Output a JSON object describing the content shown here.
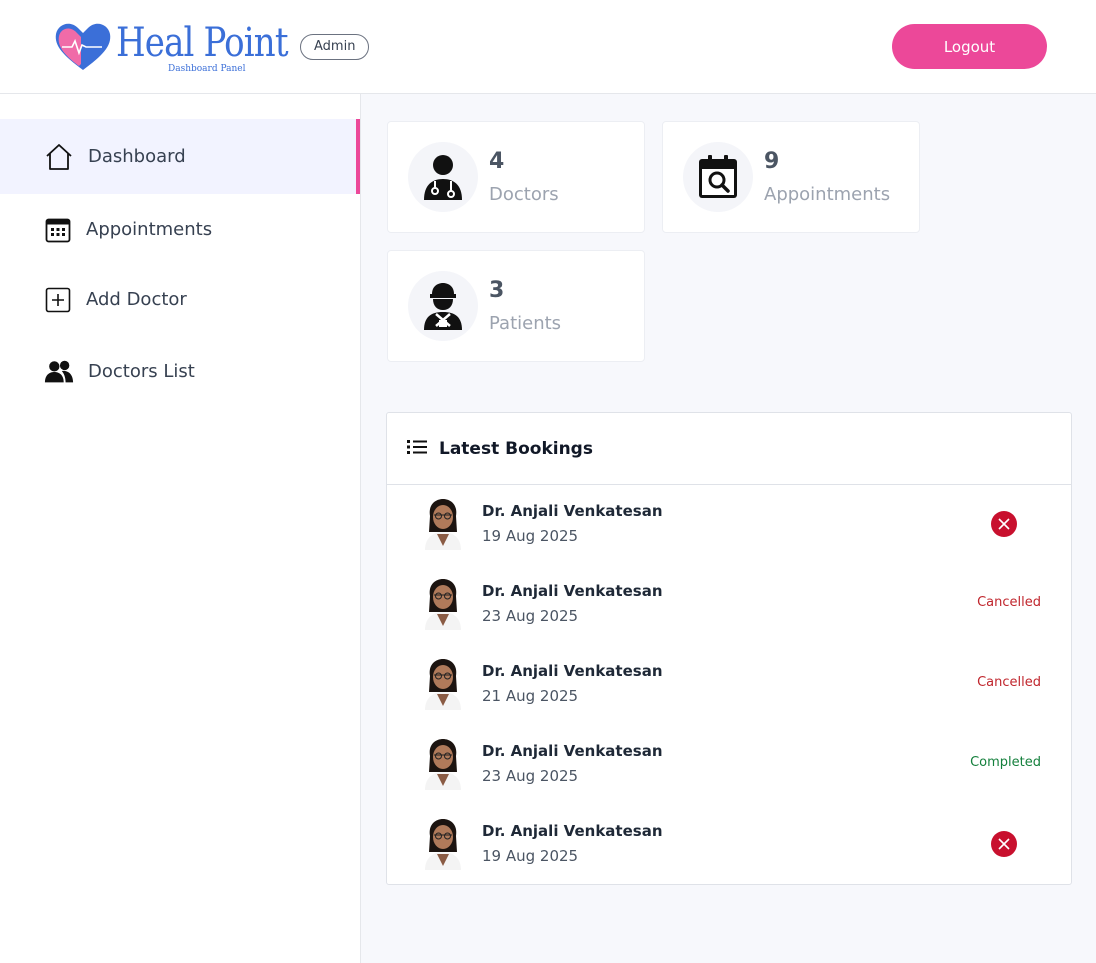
{
  "header": {
    "logo_text": "Heal Point",
    "logo_subtitle": "Dashboard Panel",
    "role_badge": "Admin",
    "logout_label": "Logout",
    "brand_color": "#ec4899",
    "logo_color": "#3b6fd8"
  },
  "sidebar": {
    "items": [
      {
        "label": "Dashboard",
        "icon": "home-icon",
        "active": true
      },
      {
        "label": "Appointments",
        "icon": "calendar-icon",
        "active": false
      },
      {
        "label": "Add Doctor",
        "icon": "plus-square-icon",
        "active": false
      },
      {
        "label": "Doctors List",
        "icon": "users-icon",
        "active": false
      }
    ]
  },
  "stats": [
    {
      "count": "4",
      "label": "Doctors",
      "icon": "doctor-icon"
    },
    {
      "count": "9",
      "label": "Appointments",
      "icon": "calendar-search-icon"
    },
    {
      "count": "3",
      "label": "Patients",
      "icon": "patient-icon"
    }
  ],
  "bookings": {
    "title": "Latest Bookings",
    "rows": [
      {
        "doctor": "Dr. Anjali Venkatesan",
        "date": "19 Aug 2025",
        "status": "",
        "action": "cancel"
      },
      {
        "doctor": "Dr. Anjali Venkatesan",
        "date": "23 Aug 2025",
        "status": "Cancelled",
        "action": ""
      },
      {
        "doctor": "Dr. Anjali Venkatesan",
        "date": "21 Aug 2025",
        "status": "Cancelled",
        "action": ""
      },
      {
        "doctor": "Dr. Anjali Venkatesan",
        "date": "23 Aug 2025",
        "status": "Completed",
        "action": ""
      },
      {
        "doctor": "Dr. Anjali Venkatesan",
        "date": "19 Aug 2025",
        "status": "",
        "action": "cancel"
      }
    ]
  },
  "colors": {
    "cancelled": "#c0262d",
    "completed": "#15803d",
    "cancel_button": "#c8102e"
  }
}
